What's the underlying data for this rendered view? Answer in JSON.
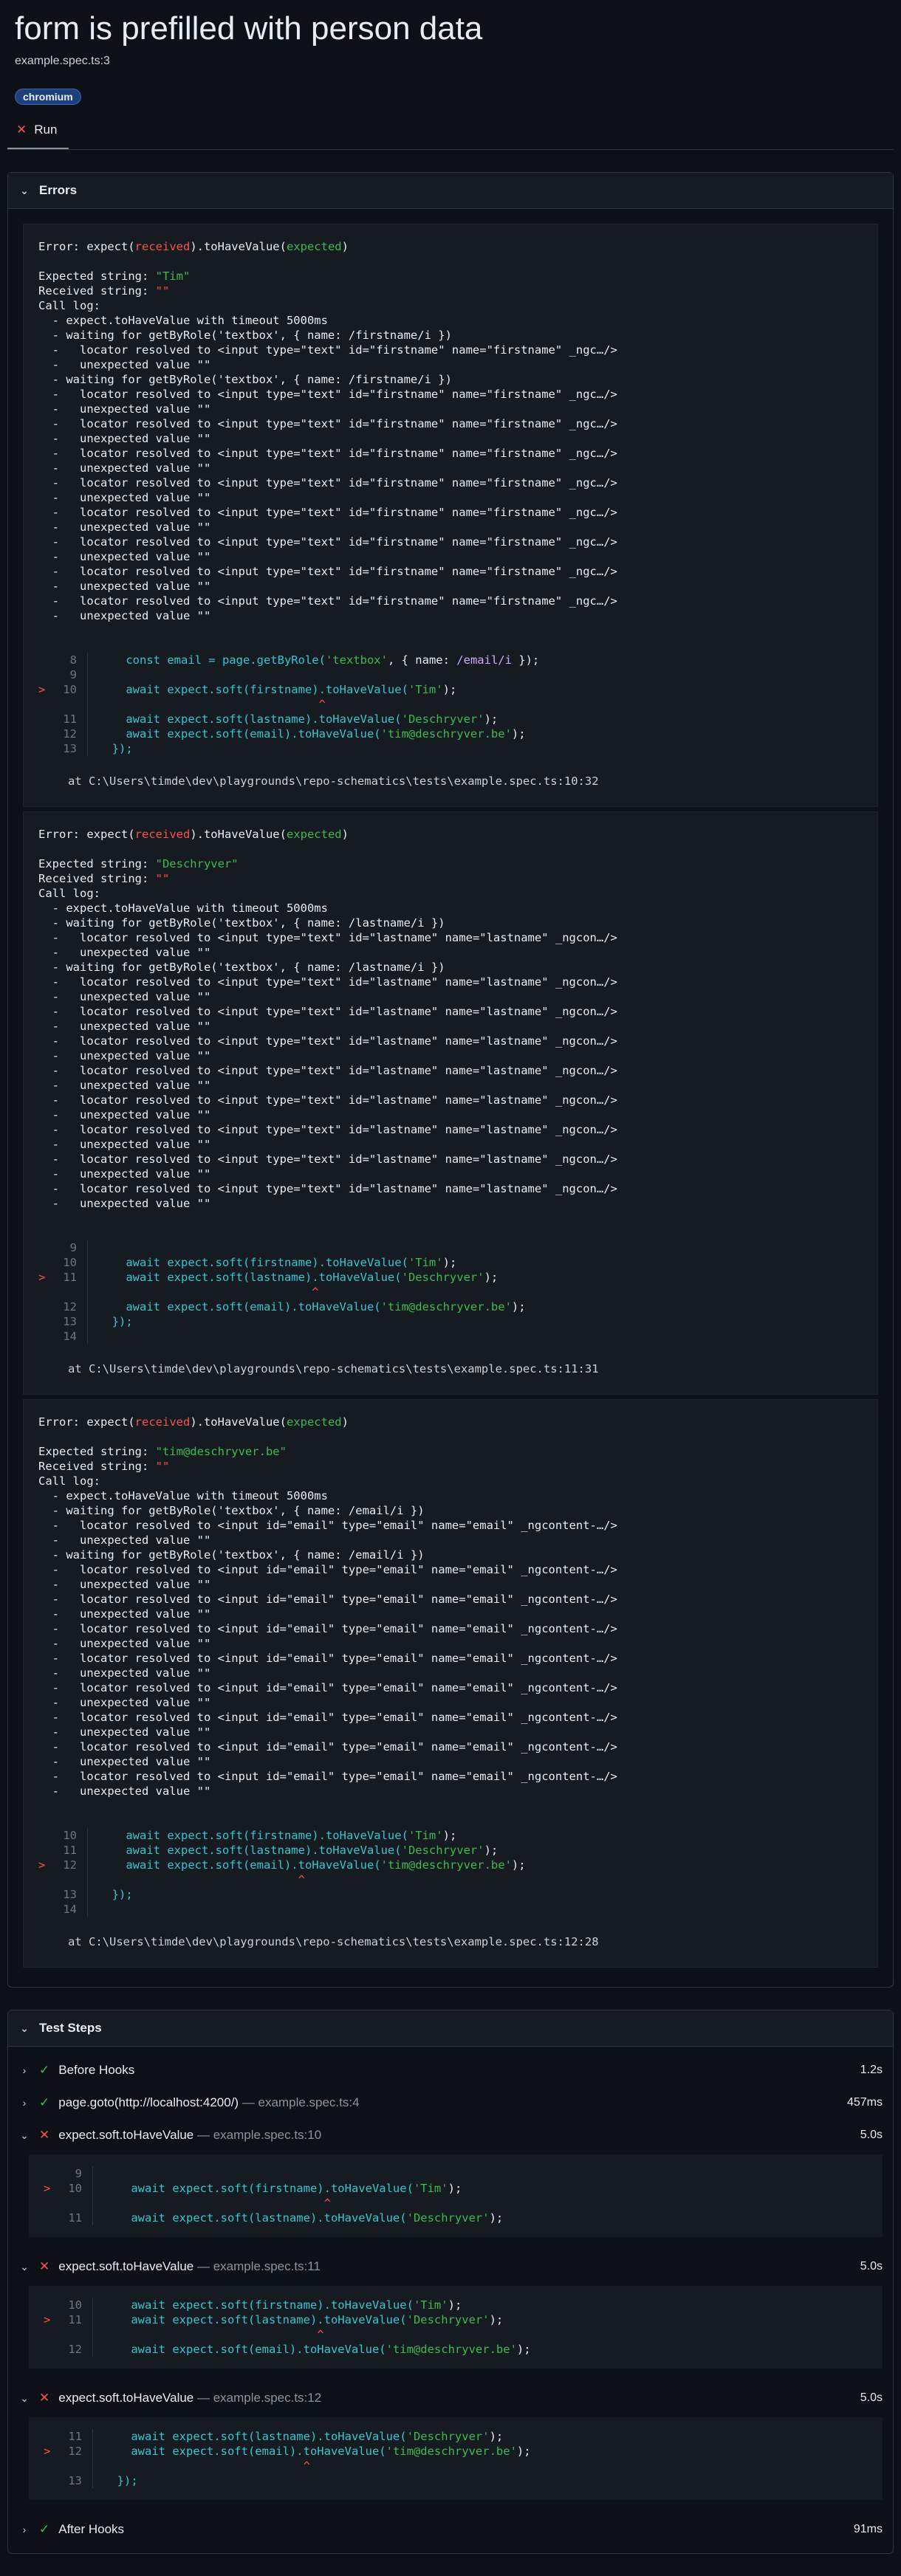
{
  "header": {
    "title": "form is prefilled with person data",
    "subtitle": "example.spec.ts:3",
    "project_badge": "chromium",
    "tab_run": "Run"
  },
  "errors": {
    "section_title": "Errors",
    "items": [
      {
        "head_prefix": "Error: expect(",
        "head_received": "received",
        "head_mid": ").toHaveValue(",
        "head_expected": "expected",
        "head_suffix": ")",
        "expected_label": "Expected string: ",
        "expected_value": "\"Tim\"",
        "received_label": "Received string: ",
        "received_value": "\"\"",
        "log": [
          "Call log:",
          "  - expect.toHaveValue with timeout 5000ms",
          "  - waiting for getByRole('textbox', { name: /firstname/i })",
          "  -   locator resolved to <input type=\"text\" id=\"firstname\" name=\"firstname\" _ngc…/>",
          "  -   unexpected value \"\"",
          "  - waiting for getByRole('textbox', { name: /firstname/i })",
          "  -   locator resolved to <input type=\"text\" id=\"firstname\" name=\"firstname\" _ngc…/>",
          "  -   unexpected value \"\"",
          "  -   locator resolved to <input type=\"text\" id=\"firstname\" name=\"firstname\" _ngc…/>",
          "  -   unexpected value \"\"",
          "  -   locator resolved to <input type=\"text\" id=\"firstname\" name=\"firstname\" _ngc…/>",
          "  -   unexpected value \"\"",
          "  -   locator resolved to <input type=\"text\" id=\"firstname\" name=\"firstname\" _ngc…/>",
          "  -   unexpected value \"\"",
          "  -   locator resolved to <input type=\"text\" id=\"firstname\" name=\"firstname\" _ngc…/>",
          "  -   unexpected value \"\"",
          "  -   locator resolved to <input type=\"text\" id=\"firstname\" name=\"firstname\" _ngc…/>",
          "  -   unexpected value \"\"",
          "  -   locator resolved to <input type=\"text\" id=\"firstname\" name=\"firstname\" _ngc…/>",
          "  -   unexpected value \"\"",
          "  -   locator resolved to <input type=\"text\" id=\"firstname\" name=\"firstname\" _ngc…/>",
          "  -   unexpected value \"\""
        ],
        "code": [
          {
            "mark": "",
            "no": "8",
            "pre": "    const email = page.getByRole(",
            "s1": "'textbox'",
            "mid": ", { name: ",
            "s2": "/email/i",
            "post": " });"
          },
          {
            "mark": "",
            "no": "9",
            "pre": "",
            "s1": "",
            "mid": "",
            "s2": "",
            "post": ""
          },
          {
            "mark": ">",
            "no": "10",
            "pre": "    await expect.soft(firstname).toHaveValue(",
            "s1": "'Tim'",
            "mid": "",
            "s2": "",
            "post": ");"
          },
          {
            "mark": "",
            "no": "",
            "pre": "                                ^",
            "s1": "",
            "mid": "",
            "s2": "",
            "post": ""
          },
          {
            "mark": "",
            "no": "11",
            "pre": "    await expect.soft(lastname).toHaveValue(",
            "s1": "'Deschryver'",
            "mid": "",
            "s2": "",
            "post": ");"
          },
          {
            "mark": "",
            "no": "12",
            "pre": "    await expect.soft(email).toHaveValue(",
            "s1": "'tim@deschryver.be'",
            "mid": "",
            "s2": "",
            "post": ");"
          },
          {
            "mark": "",
            "no": "13",
            "pre": "  });",
            "s1": "",
            "mid": "",
            "s2": "",
            "post": ""
          }
        ],
        "at": "at C:\\Users\\timde\\dev\\playgrounds\\repo-schematics\\tests\\example.spec.ts:10:32"
      },
      {
        "head_prefix": "Error: expect(",
        "head_received": "received",
        "head_mid": ").toHaveValue(",
        "head_expected": "expected",
        "head_suffix": ")",
        "expected_label": "Expected string: ",
        "expected_value": "\"Deschryver\"",
        "received_label": "Received string: ",
        "received_value": "\"\"",
        "log": [
          "Call log:",
          "  - expect.toHaveValue with timeout 5000ms",
          "  - waiting for getByRole('textbox', { name: /lastname/i })",
          "  -   locator resolved to <input type=\"text\" id=\"lastname\" name=\"lastname\" _ngcon…/>",
          "  -   unexpected value \"\"",
          "  - waiting for getByRole('textbox', { name: /lastname/i })",
          "  -   locator resolved to <input type=\"text\" id=\"lastname\" name=\"lastname\" _ngcon…/>",
          "  -   unexpected value \"\"",
          "  -   locator resolved to <input type=\"text\" id=\"lastname\" name=\"lastname\" _ngcon…/>",
          "  -   unexpected value \"\"",
          "  -   locator resolved to <input type=\"text\" id=\"lastname\" name=\"lastname\" _ngcon…/>",
          "  -   unexpected value \"\"",
          "  -   locator resolved to <input type=\"text\" id=\"lastname\" name=\"lastname\" _ngcon…/>",
          "  -   unexpected value \"\"",
          "  -   locator resolved to <input type=\"text\" id=\"lastname\" name=\"lastname\" _ngcon…/>",
          "  -   unexpected value \"\"",
          "  -   locator resolved to <input type=\"text\" id=\"lastname\" name=\"lastname\" _ngcon…/>",
          "  -   unexpected value \"\"",
          "  -   locator resolved to <input type=\"text\" id=\"lastname\" name=\"lastname\" _ngcon…/>",
          "  -   unexpected value \"\"",
          "  -   locator resolved to <input type=\"text\" id=\"lastname\" name=\"lastname\" _ngcon…/>",
          "  -   unexpected value \"\""
        ],
        "code": [
          {
            "mark": "",
            "no": "9",
            "pre": "",
            "s1": "",
            "mid": "",
            "s2": "",
            "post": ""
          },
          {
            "mark": "",
            "no": "10",
            "pre": "    await expect.soft(firstname).toHaveValue(",
            "s1": "'Tim'",
            "mid": "",
            "s2": "",
            "post": ");"
          },
          {
            "mark": ">",
            "no": "11",
            "pre": "    await expect.soft(lastname).toHaveValue(",
            "s1": "'Deschryver'",
            "mid": "",
            "s2": "",
            "post": ");"
          },
          {
            "mark": "",
            "no": "",
            "pre": "                               ^",
            "s1": "",
            "mid": "",
            "s2": "",
            "post": ""
          },
          {
            "mark": "",
            "no": "12",
            "pre": "    await expect.soft(email).toHaveValue(",
            "s1": "'tim@deschryver.be'",
            "mid": "",
            "s2": "",
            "post": ");"
          },
          {
            "mark": "",
            "no": "13",
            "pre": "  });",
            "s1": "",
            "mid": "",
            "s2": "",
            "post": ""
          },
          {
            "mark": "",
            "no": "14",
            "pre": "",
            "s1": "",
            "mid": "",
            "s2": "",
            "post": ""
          }
        ],
        "at": "at C:\\Users\\timde\\dev\\playgrounds\\repo-schematics\\tests\\example.spec.ts:11:31"
      },
      {
        "head_prefix": "Error: expect(",
        "head_received": "received",
        "head_mid": ").toHaveValue(",
        "head_expected": "expected",
        "head_suffix": ")",
        "expected_label": "Expected string: ",
        "expected_value": "\"tim@deschryver.be\"",
        "received_label": "Received string: ",
        "received_value": "\"\"",
        "log": [
          "Call log:",
          "  - expect.toHaveValue with timeout 5000ms",
          "  - waiting for getByRole('textbox', { name: /email/i })",
          "  -   locator resolved to <input id=\"email\" type=\"email\" name=\"email\" _ngcontent-…/>",
          "  -   unexpected value \"\"",
          "  - waiting for getByRole('textbox', { name: /email/i })",
          "  -   locator resolved to <input id=\"email\" type=\"email\" name=\"email\" _ngcontent-…/>",
          "  -   unexpected value \"\"",
          "  -   locator resolved to <input id=\"email\" type=\"email\" name=\"email\" _ngcontent-…/>",
          "  -   unexpected value \"\"",
          "  -   locator resolved to <input id=\"email\" type=\"email\" name=\"email\" _ngcontent-…/>",
          "  -   unexpected value \"\"",
          "  -   locator resolved to <input id=\"email\" type=\"email\" name=\"email\" _ngcontent-…/>",
          "  -   unexpected value \"\"",
          "  -   locator resolved to <input id=\"email\" type=\"email\" name=\"email\" _ngcontent-…/>",
          "  -   unexpected value \"\"",
          "  -   locator resolved to <input id=\"email\" type=\"email\" name=\"email\" _ngcontent-…/>",
          "  -   unexpected value \"\"",
          "  -   locator resolved to <input id=\"email\" type=\"email\" name=\"email\" _ngcontent-…/>",
          "  -   unexpected value \"\"",
          "  -   locator resolved to <input id=\"email\" type=\"email\" name=\"email\" _ngcontent-…/>",
          "  -   unexpected value \"\""
        ],
        "code": [
          {
            "mark": "",
            "no": "10",
            "pre": "    await expect.soft(firstname).toHaveValue(",
            "s1": "'Tim'",
            "mid": "",
            "s2": "",
            "post": ");"
          },
          {
            "mark": "",
            "no": "11",
            "pre": "    await expect.soft(lastname).toHaveValue(",
            "s1": "'Deschryver'",
            "mid": "",
            "s2": "",
            "post": ");"
          },
          {
            "mark": ">",
            "no": "12",
            "pre": "    await expect.soft(email).toHaveValue(",
            "s1": "'tim@deschryver.be'",
            "mid": "",
            "s2": "",
            "post": ");"
          },
          {
            "mark": "",
            "no": "",
            "pre": "                             ^",
            "s1": "",
            "mid": "",
            "s2": "",
            "post": ""
          },
          {
            "mark": "",
            "no": "13",
            "pre": "  });",
            "s1": "",
            "mid": "",
            "s2": "",
            "post": ""
          },
          {
            "mark": "",
            "no": "14",
            "pre": "",
            "s1": "",
            "mid": "",
            "s2": "",
            "post": ""
          }
        ],
        "at": "at C:\\Users\\timde\\dev\\playgrounds\\repo-schematics\\tests\\example.spec.ts:12:28"
      }
    ]
  },
  "steps": {
    "section_title": "Test Steps",
    "items": [
      {
        "status": "pass",
        "expanded": false,
        "title": "Before Hooks",
        "loc": "",
        "duration": "1.2s",
        "code": []
      },
      {
        "status": "pass",
        "expanded": false,
        "title": "page.goto(http://localhost:4200/)",
        "loc": " — example.spec.ts:4",
        "duration": "457ms",
        "code": []
      },
      {
        "status": "fail",
        "expanded": true,
        "title": "expect.soft.toHaveValue",
        "loc": " — example.spec.ts:10",
        "duration": "5.0s",
        "code": [
          {
            "mark": "",
            "no": "9",
            "pre": "",
            "s1": "",
            "post": ""
          },
          {
            "mark": ">",
            "no": "10",
            "pre": "    await expect.soft(firstname).toHaveValue(",
            "s1": "'Tim'",
            "post": ");"
          },
          {
            "mark": "",
            "no": "",
            "pre": "                                ^",
            "s1": "",
            "post": ""
          },
          {
            "mark": "",
            "no": "11",
            "pre": "    await expect.soft(lastname).toHaveValue(",
            "s1": "'Deschryver'",
            "post": ");"
          }
        ]
      },
      {
        "status": "fail",
        "expanded": true,
        "title": "expect.soft.toHaveValue",
        "loc": " — example.spec.ts:11",
        "duration": "5.0s",
        "code": [
          {
            "mark": "",
            "no": "10",
            "pre": "    await expect.soft(firstname).toHaveValue(",
            "s1": "'Tim'",
            "post": ");"
          },
          {
            "mark": ">",
            "no": "11",
            "pre": "    await expect.soft(lastname).toHaveValue(",
            "s1": "'Deschryver'",
            "post": ");"
          },
          {
            "mark": "",
            "no": "",
            "pre": "                               ^",
            "s1": "",
            "post": ""
          },
          {
            "mark": "",
            "no": "12",
            "pre": "    await expect.soft(email).toHaveValue(",
            "s1": "'tim@deschryver.be'",
            "post": ");"
          }
        ]
      },
      {
        "status": "fail",
        "expanded": true,
        "title": "expect.soft.toHaveValue",
        "loc": " — example.spec.ts:12",
        "duration": "5.0s",
        "code": [
          {
            "mark": "",
            "no": "11",
            "pre": "    await expect.soft(lastname).toHaveValue(",
            "s1": "'Deschryver'",
            "post": ");"
          },
          {
            "mark": ">",
            "no": "12",
            "pre": "    await expect.soft(email).toHaveValue(",
            "s1": "'tim@deschryver.be'",
            "post": ");"
          },
          {
            "mark": "",
            "no": "",
            "pre": "                             ^",
            "s1": "",
            "post": ""
          },
          {
            "mark": "",
            "no": "13",
            "pre": "  });",
            "s1": "",
            "post": ""
          }
        ]
      },
      {
        "status": "pass",
        "expanded": false,
        "title": "After Hooks",
        "loc": "",
        "duration": "91ms",
        "code": []
      }
    ]
  },
  "icons": {
    "chevron_down": "chevron-down-icon",
    "chevron_right": "chevron-right-icon",
    "check": "check-icon",
    "cross": "cross-icon"
  },
  "colors": {
    "background": "#0d1117",
    "error": "#f85149",
    "success": "#3fb950",
    "accent": "#1f3f7a"
  }
}
